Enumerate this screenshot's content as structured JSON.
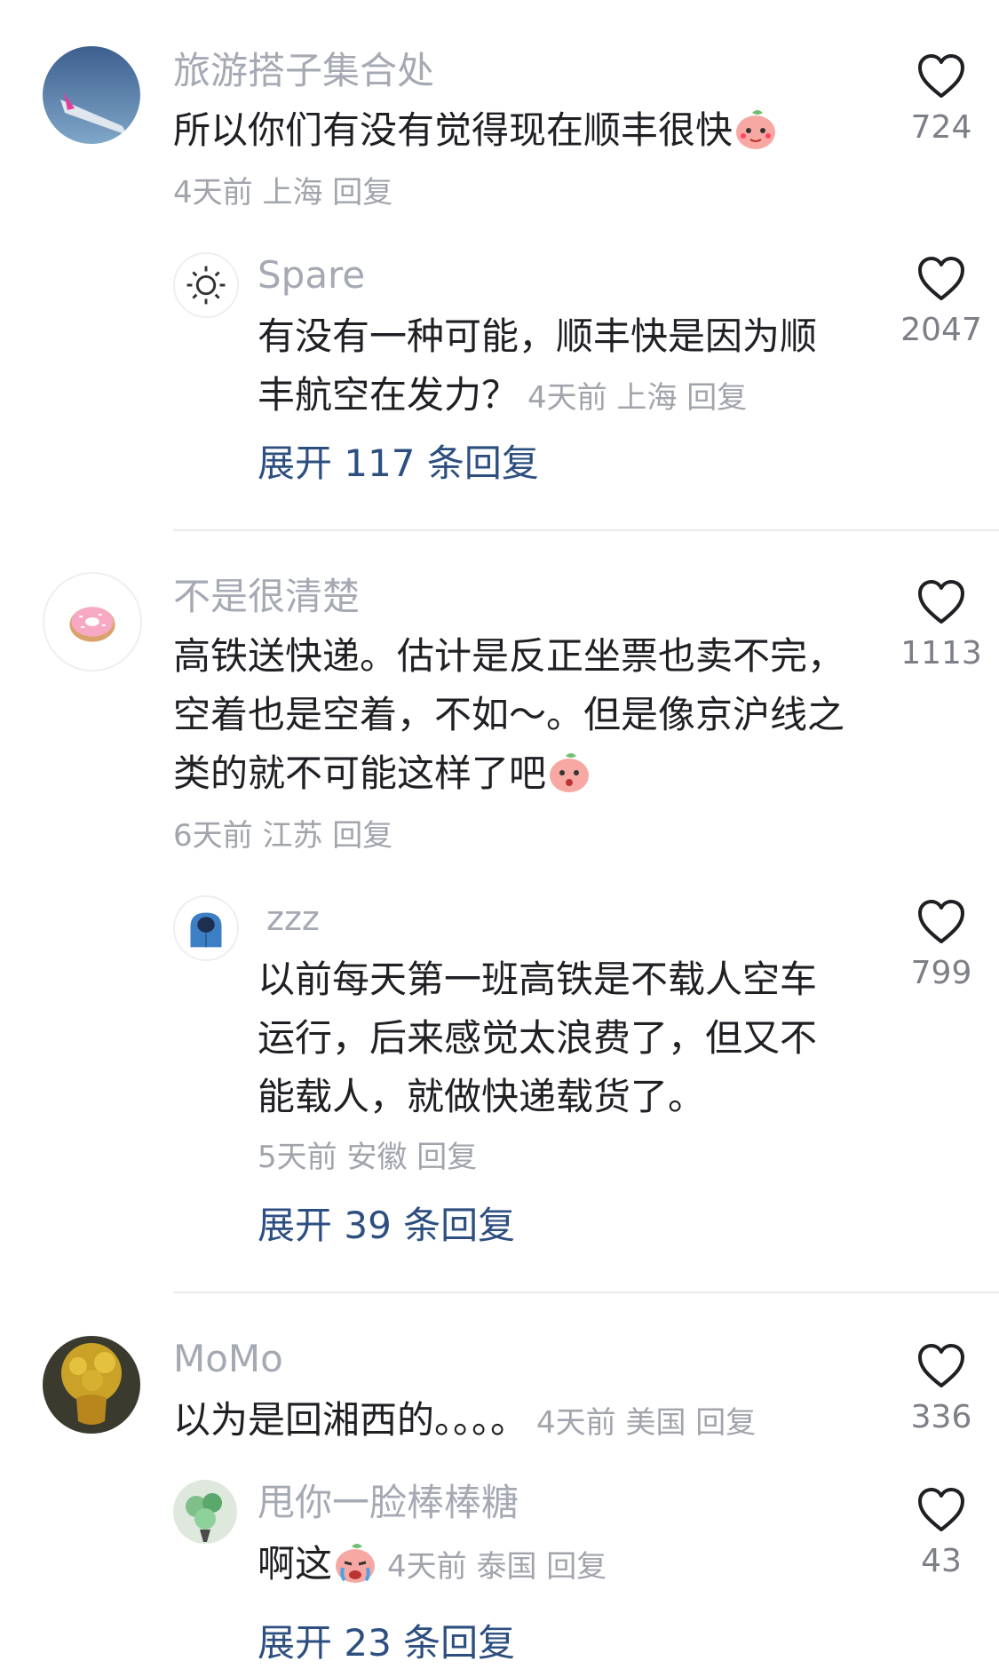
{
  "comments": [
    {
      "user": "旅游搭子集合处",
      "text": "所以你们有没有觉得现在顺丰很快",
      "time": "4天前",
      "location": "上海",
      "reply_label": "回复",
      "likes": "724",
      "replies": [
        {
          "user": "Spare",
          "text": "有没有一种可能，顺丰快是因为顺丰航空在发力？",
          "time": "4天前",
          "location": "上海",
          "reply_label": "回复",
          "likes": "2047"
        }
      ],
      "expand_label": "展开 117 条回复"
    },
    {
      "user": "不是很清楚",
      "text": "高铁送快递。估计是反正坐票也卖不完，空着也是空着，不如～。但是像京沪线之类的就不可能这样了吧",
      "time": "6天前",
      "location": "江苏",
      "reply_label": "回复",
      "likes": "1113",
      "replies": [
        {
          "user": "zzz",
          "text": "以前每天第一班高铁是不载人空车运行，后来感觉太浪费了，但又不能载人，就做快递载货了。",
          "time": "5天前",
          "location": "安徽",
          "reply_label": "回复",
          "likes": "799"
        }
      ],
      "expand_label": "展开 39 条回复"
    },
    {
      "user": "MoMo",
      "text": "以为是回湘西的。。。。",
      "time": "4天前",
      "location": "美国",
      "reply_label": "回复",
      "likes": "336",
      "replies": [
        {
          "user": "甩你一脸棒棒糖",
          "text": "啊这",
          "time": "4天前",
          "location": "泰国",
          "reply_label": "回复",
          "likes": "43"
        }
      ],
      "expand_label": "展开 23 条回复"
    }
  ],
  "icons": {
    "like": "heart-outline-icon",
    "emoji": "peach-emoji-icon"
  },
  "colors": {
    "link": "#2d4f80",
    "secondary_text": "#a1a4ab",
    "primary_text": "#1f1f24"
  }
}
